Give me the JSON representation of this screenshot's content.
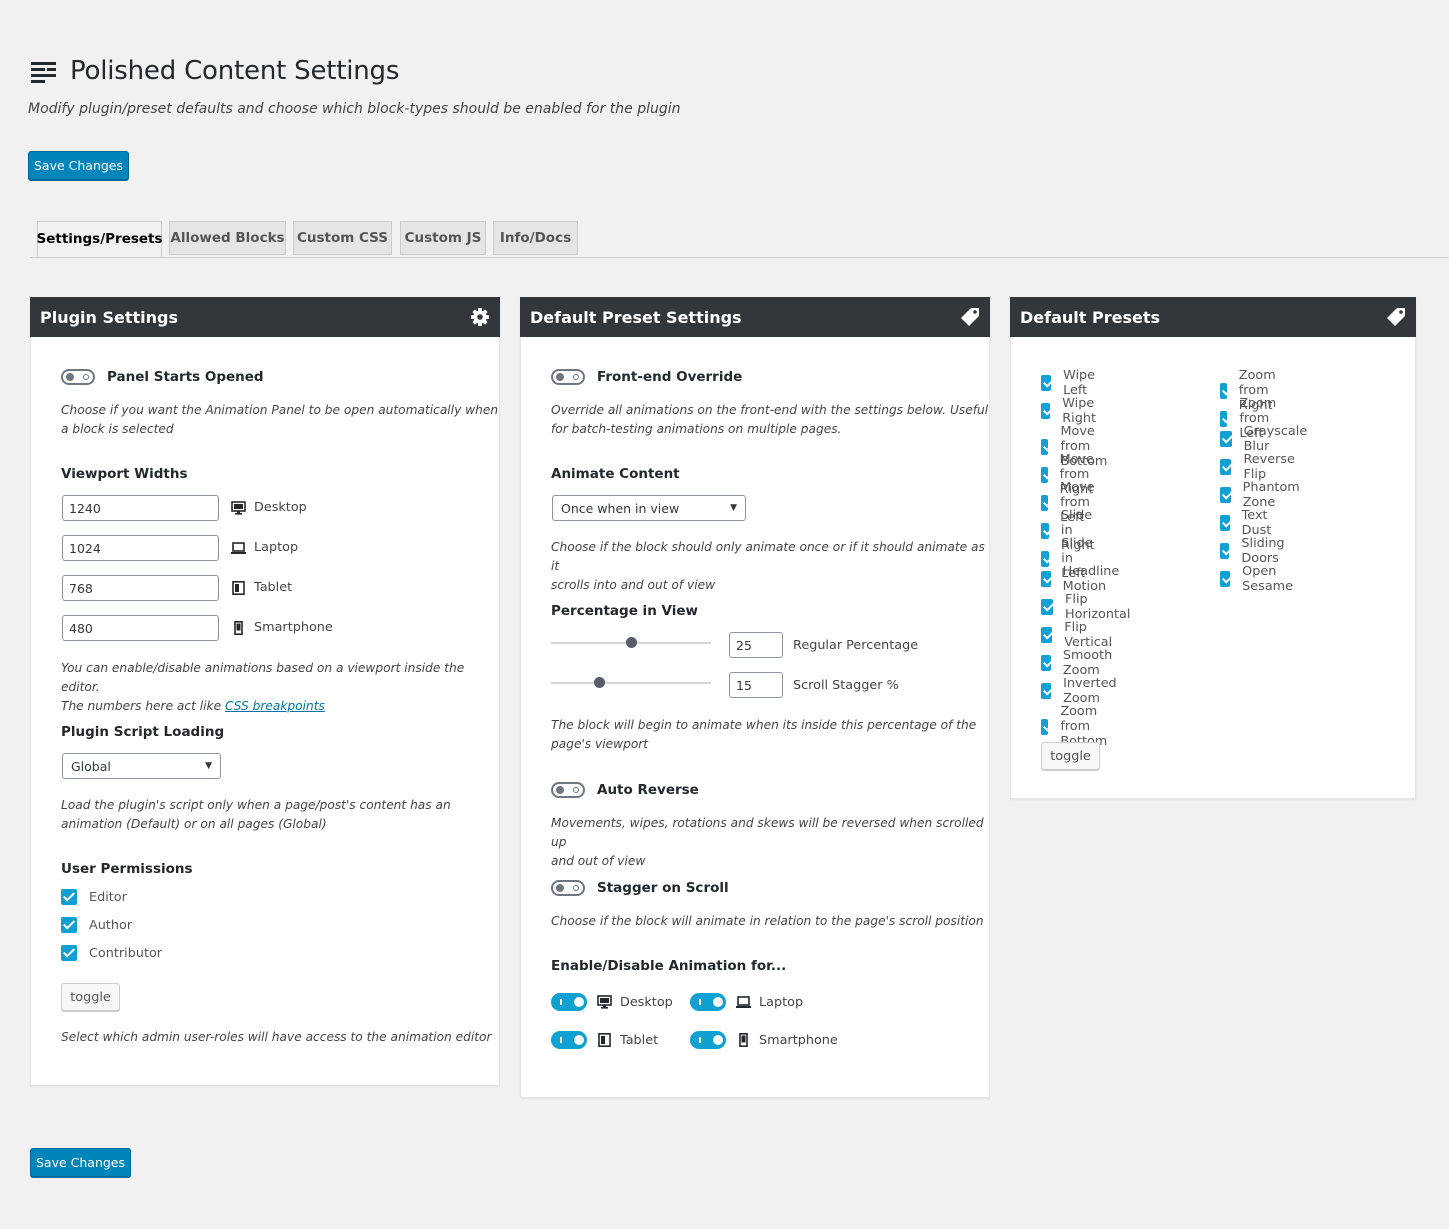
{
  "page": {
    "title": "Polished Content Settings",
    "description": "Modify plugin/preset defaults and choose which block-types should be enabled for the plugin",
    "save_top": "Save Changes",
    "save_bottom": "Save Changes"
  },
  "tabs": [
    "Settings/Presets",
    "Allowed Blocks",
    "Custom CSS",
    "Custom JS",
    "Info/Docs"
  ],
  "plugin_settings": {
    "title": "Plugin Settings",
    "panel_toggle_label": "Panel Starts Opened",
    "panel_help_1": "Choose if you want the Animation Panel to be open automatically when",
    "panel_help_2": "a block is selected",
    "viewport_title": "Viewport Widths",
    "viewports": [
      {
        "value": "1240",
        "label": "Desktop"
      },
      {
        "value": "1024",
        "label": "Laptop"
      },
      {
        "value": "768",
        "label": "Tablet"
      },
      {
        "value": "480",
        "label": "Smartphone"
      }
    ],
    "viewport_help_1": "You can enable/disable animations based on a viewport inside the editor.",
    "viewport_help_2": "The numbers here act like ",
    "viewport_help_link": "CSS breakpoints",
    "script_title": "Plugin Script Loading",
    "script_value": "Global",
    "script_help_1": "Load the plugin's script only when a page/post's content has an",
    "script_help_2": "animation (Default) or on all pages (Global)",
    "permissions_title": "User Permissions",
    "permissions": [
      "Editor",
      "Author",
      "Contributor"
    ],
    "toggle_label": "toggle",
    "permissions_help": "Select which admin user-roles will have access to the animation editor"
  },
  "preset_settings": {
    "title": "Default Preset Settings",
    "override_label": "Front-end Override",
    "override_help_1": "Override all animations on the front-end with the settings below. Useful",
    "override_help_2": "for batch-testing animations on multiple pages.",
    "animate_title": "Animate Content",
    "animate_value": "Once when in view",
    "animate_help_1": "Choose if the block should only animate once or if it should animate as it",
    "animate_help_2": "scrolls into and out of view",
    "percent_title": "Percentage in View",
    "regular_value": "25",
    "regular_label": "Regular Percentage",
    "regular_percent": 25,
    "stagger_value": "15",
    "stagger_label": "Scroll Stagger %",
    "stagger_percent": 15,
    "percent_help_1": "The block will begin to animate when its inside this percentage of the",
    "percent_help_2": "page's viewport",
    "reverse_label": "Auto Reverse",
    "reverse_help_1": "Movements, wipes, rotations and skews will be reversed when scrolled up",
    "reverse_help_2": "and out of view",
    "stagger_scroll_label": "Stagger on Scroll",
    "stagger_scroll_help": "Choose if the block will animate in relation to the page's scroll position",
    "enable_title": "Enable/Disable Animation for...",
    "devices": [
      "Desktop",
      "Laptop",
      "Tablet",
      "Smartphone"
    ]
  },
  "default_presets": {
    "title": "Default Presets",
    "col1": [
      "Wipe Left",
      "Wipe Right",
      "Move from Bottom",
      "Move from Right",
      "Move from Left",
      "Slide in Right",
      "Slide in Left",
      "Headline Motion",
      "Flip Horizontal",
      "Flip Vertical",
      "Smooth Zoom",
      "Inverted Zoom",
      "Zoom from Bottom"
    ],
    "col2": [
      "Zoom from Right",
      "Zoom from Left",
      "Grayscale Blur",
      "Reverse Flip",
      "Phantom Zone",
      "Text Dust",
      "Sliding Doors",
      "Open Sesame"
    ],
    "toggle_label": "toggle"
  },
  "colors": {
    "accent": "#0085ba",
    "checkbox": "#11a0d2",
    "panel_header": "#32373c",
    "background": "#f1f1f1"
  }
}
